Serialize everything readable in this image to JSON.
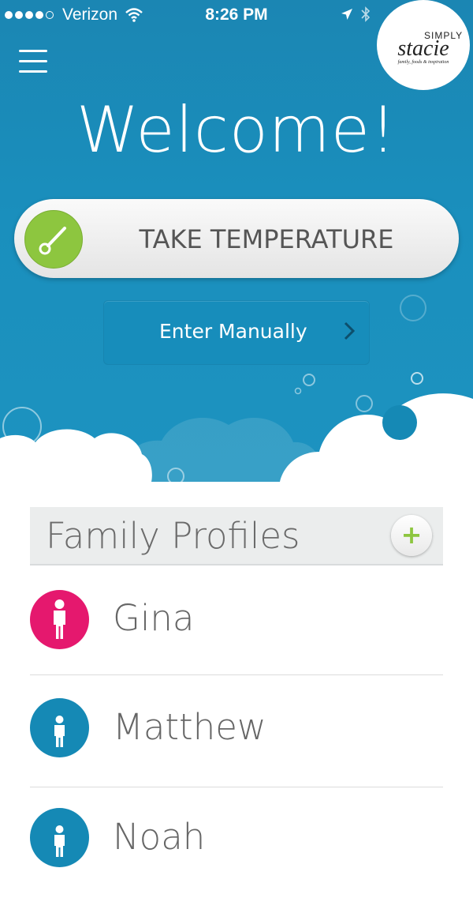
{
  "status_bar": {
    "carrier": "Verizon",
    "time": "8:26 PM",
    "signal_bars": 4,
    "signal_max": 5
  },
  "logo": {
    "line1": "SIMPLY",
    "line2": "stacie",
    "line3": "family, foods & inspiration"
  },
  "welcome": "Welcome!",
  "take_temperature": {
    "label": "TAKE TEMPERATURE",
    "icon": "thermometer-icon"
  },
  "enter_manually": {
    "label": "Enter Manually",
    "icon": "chevron-right-icon"
  },
  "family_profiles": {
    "title": "Family Profiles",
    "add_label": "+",
    "profiles": [
      {
        "name": "Gina",
        "color": "#e5186e",
        "icon": "female-person-icon"
      },
      {
        "name": "Matthew",
        "color": "#1589b5",
        "icon": "child-person-icon"
      },
      {
        "name": "Noah",
        "color": "#1589b5",
        "icon": "child-person-icon"
      }
    ]
  },
  "colors": {
    "hero_blue": "#1a8fbd",
    "accent_green": "#8dc63f",
    "pink": "#e5186e",
    "profile_blue": "#1589b5"
  }
}
